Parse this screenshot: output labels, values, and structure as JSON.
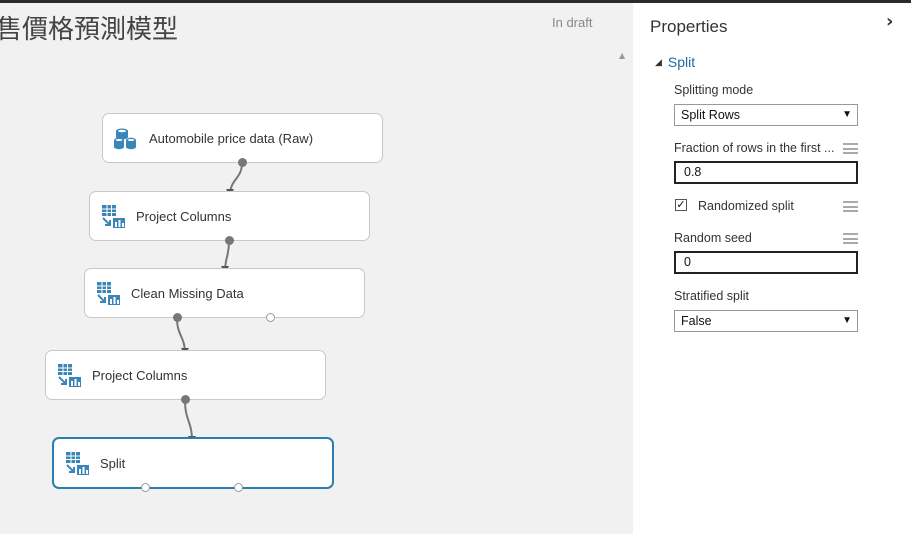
{
  "experiment": {
    "title": "售價格預測模型",
    "status": "In draft"
  },
  "nodes": [
    {
      "id": "raw",
      "label": "Automobile price data (Raw)",
      "icon": "database-icon"
    },
    {
      "id": "project1",
      "label": "Project Columns",
      "icon": "module-icon"
    },
    {
      "id": "clean",
      "label": "Clean Missing Data",
      "icon": "module-icon"
    },
    {
      "id": "project2",
      "label": "Project Columns",
      "icon": "module-icon"
    },
    {
      "id": "split",
      "label": "Split",
      "icon": "module-icon",
      "selected": true
    }
  ],
  "properties": {
    "title": "Properties",
    "section": "Split",
    "splitting_mode": {
      "label": "Splitting mode",
      "value": "Split Rows"
    },
    "fraction": {
      "label": "Fraction of rows in the first ...",
      "value": "0.8"
    },
    "randomized": {
      "label": "Randomized split",
      "checked": true
    },
    "random_seed": {
      "label": "Random seed",
      "value": "0"
    },
    "stratified": {
      "label": "Stratified split",
      "value": "False"
    }
  },
  "colors": {
    "accent": "#2a7fb0",
    "link": "#1f6aa5",
    "icon": "#3a86b8"
  }
}
